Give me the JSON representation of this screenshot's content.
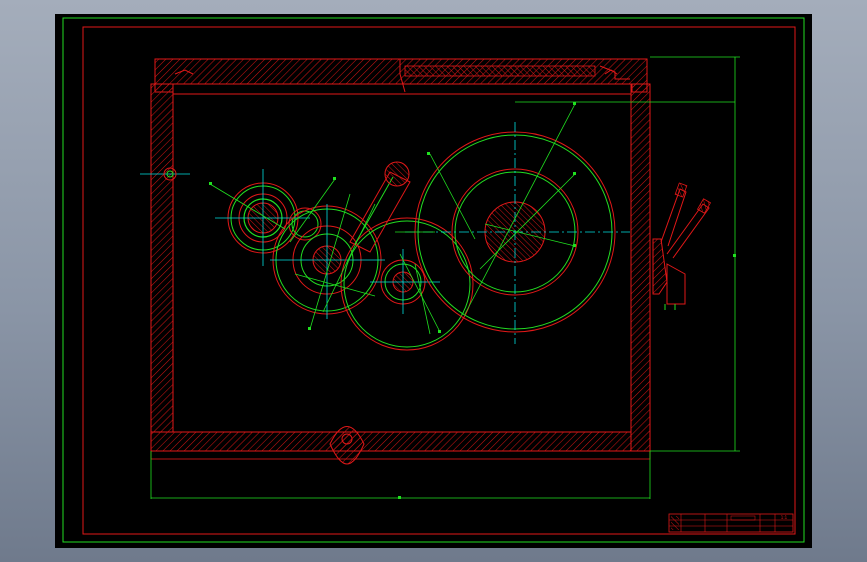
{
  "drawing": {
    "title_block": {
      "drawing_name": "",
      "scale": "1:1",
      "sheet": "",
      "rows": [
        "",
        "",
        ""
      ]
    },
    "dimensions": {
      "overall_width": "",
      "overall_height": ""
    }
  },
  "colors": {
    "background": "#000000",
    "frame_green": "#22dd22",
    "outline_red": "#e01818",
    "center_cyan": "#00e0e0",
    "hatch_red": "#c81414",
    "dim_green": "#20e020"
  }
}
